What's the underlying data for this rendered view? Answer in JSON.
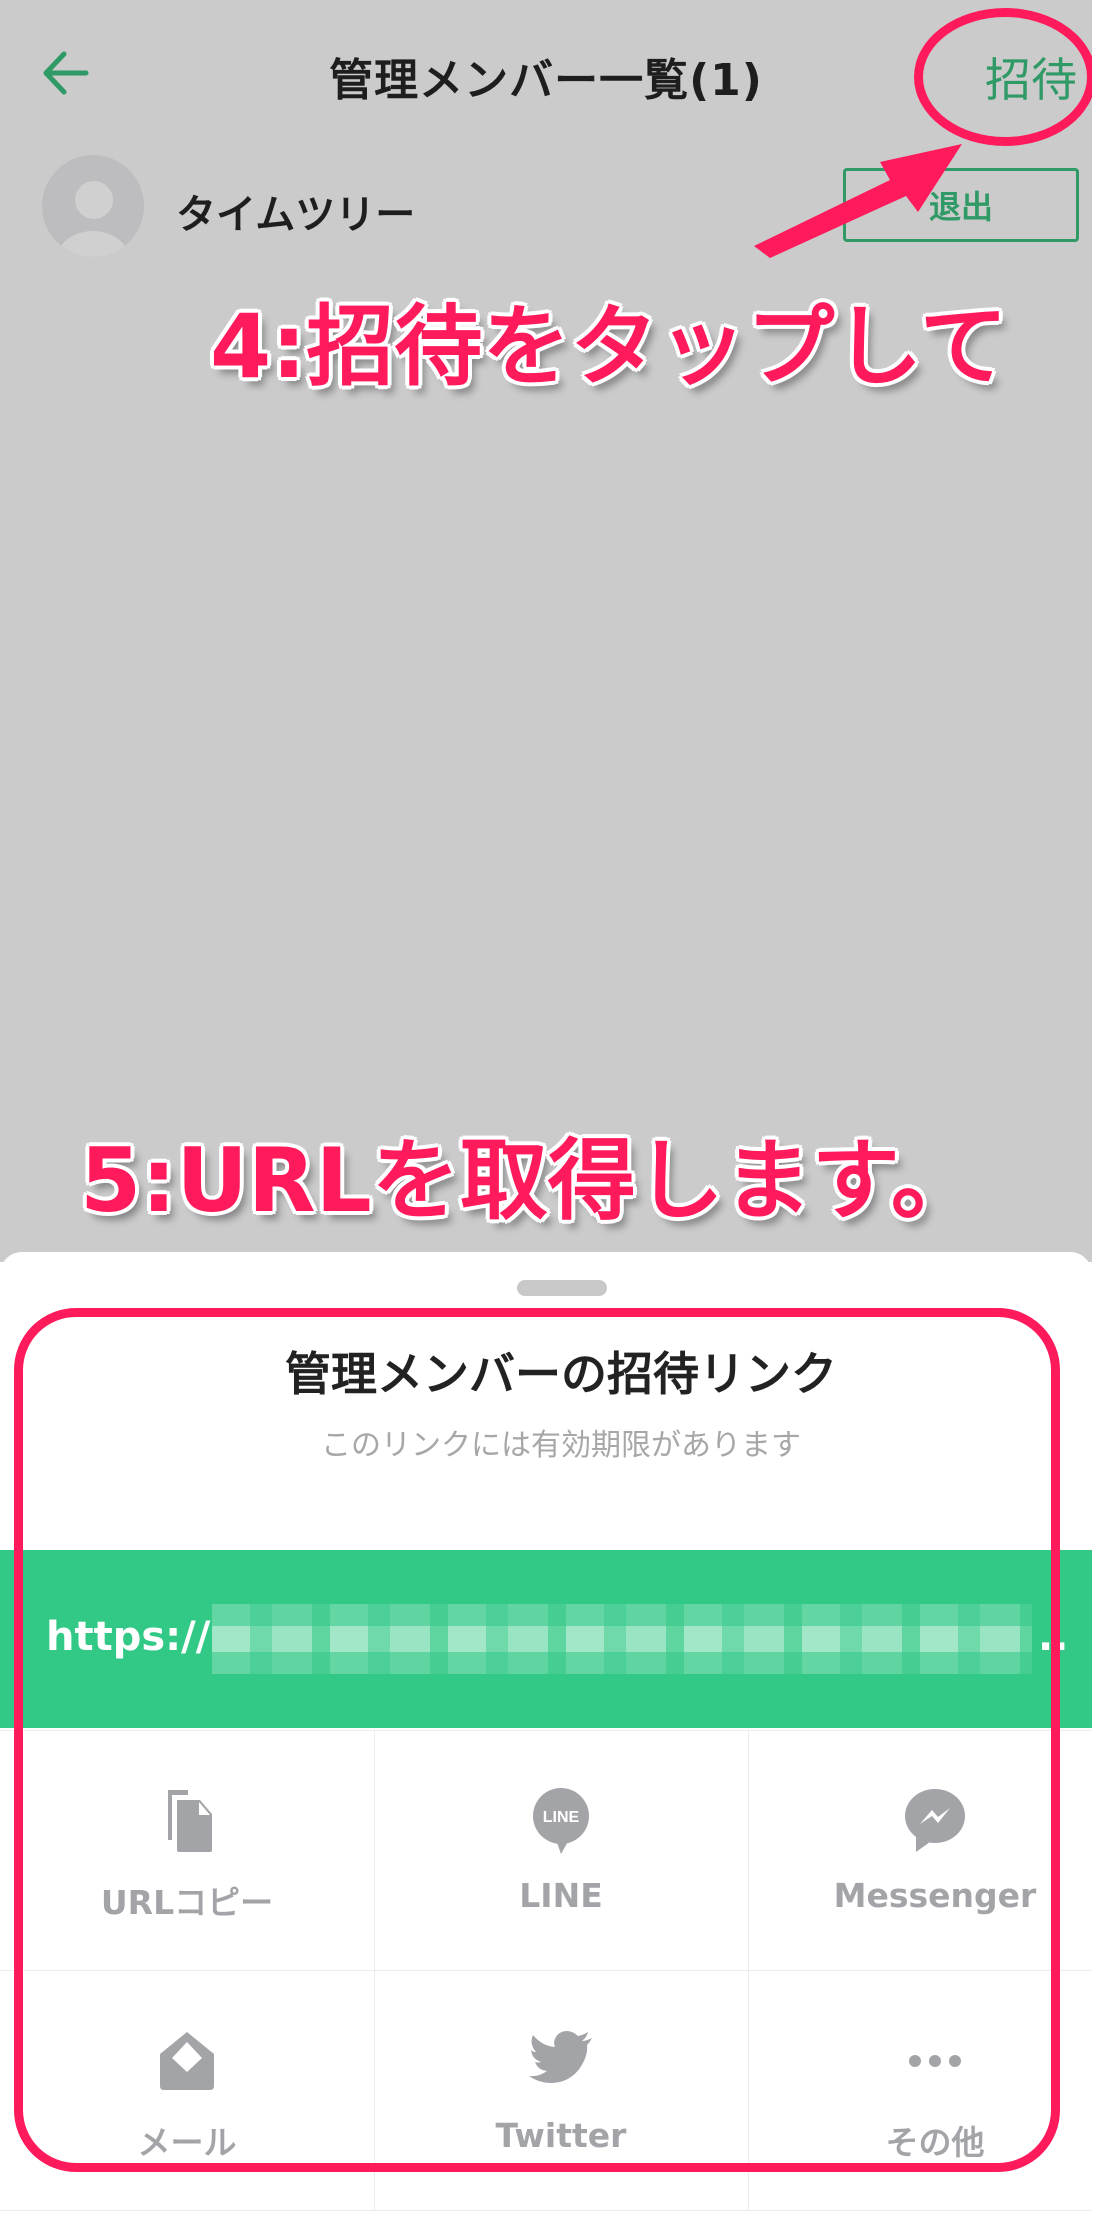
{
  "header": {
    "back_icon": "arrow-left-icon",
    "title": "管理メンバー一覧(1)",
    "invite_label": "招待"
  },
  "members": [
    {
      "name": "タイムツリー",
      "avatar_icon": "default-avatar-icon",
      "action_label": "退出"
    }
  ],
  "annotations": {
    "step4": "4:招待をタップして",
    "step5": "5:URLを取得します。"
  },
  "sheet": {
    "title": "管理メンバーの招待リンク",
    "subtitle": "このリンクには有効期限があります",
    "url_prefix": "https://",
    "url_ellipsis": "..",
    "options": [
      {
        "label": "URLコピー",
        "icon": "copy-icon"
      },
      {
        "label": "LINE",
        "icon": "line-icon"
      },
      {
        "label": "Messenger",
        "icon": "messenger-icon"
      },
      {
        "label": "メール",
        "icon": "mail-icon"
      },
      {
        "label": "Twitter",
        "icon": "twitter-icon"
      },
      {
        "label": "その他",
        "icon": "more-icon"
      }
    ]
  },
  "colors": {
    "accent_green": "#2f9a66",
    "url_bar_green": "#32c986",
    "annotation_pink": "#ff1a5c",
    "overlay_gray": "#cbcbcb",
    "icon_gray": "#a3a4a8"
  }
}
